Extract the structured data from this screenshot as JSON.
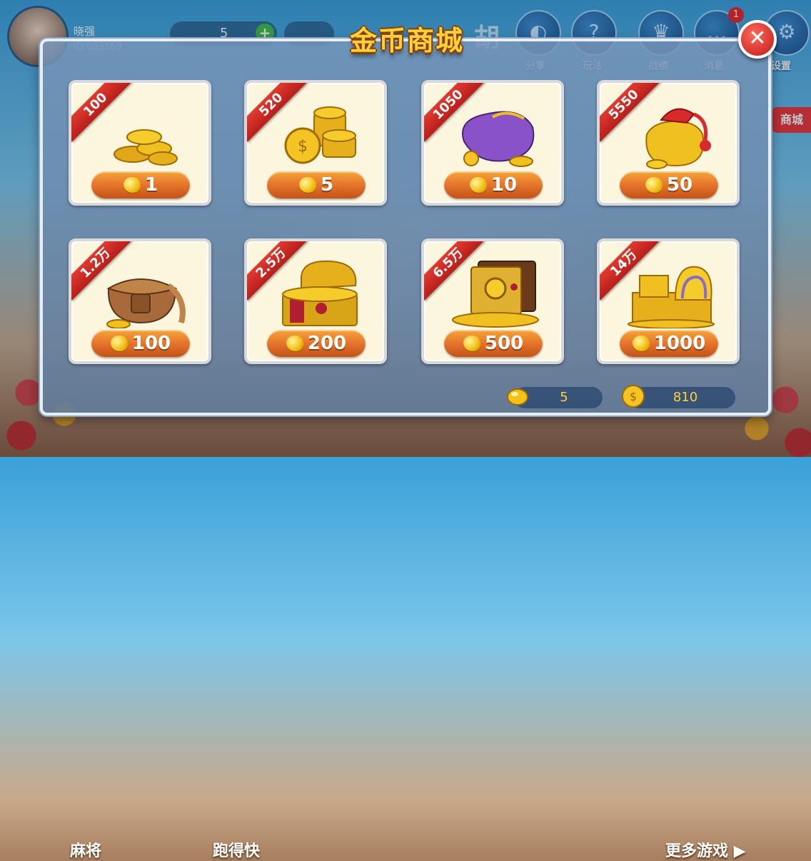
{
  "topbar": {
    "username": "晓强",
    "user_id": "ID:683169",
    "beans": "5",
    "add_symbol": "+",
    "banner_char": "胡",
    "buttons": [
      {
        "label": "分享",
        "icon": "share-icon"
      },
      {
        "label": "玩法",
        "icon": "help-icon"
      },
      {
        "label": "战绩",
        "icon": "trophy-icon"
      },
      {
        "label": "消息",
        "icon": "message-icon"
      },
      {
        "label": "设置",
        "icon": "gear-icon"
      }
    ],
    "message_badge": "1",
    "mall_tab": "商城"
  },
  "bottom": {
    "games": [
      "麻将",
      "跑得快"
    ],
    "more": "更多游戏"
  },
  "shop": {
    "title": "金币商城",
    "close_symbol": "✕",
    "items": [
      {
        "amount": "100",
        "price": "1"
      },
      {
        "amount": "520",
        "price": "5"
      },
      {
        "amount": "1050",
        "price": "10"
      },
      {
        "amount": "5550",
        "price": "50"
      },
      {
        "amount": "1.2万",
        "price": "100"
      },
      {
        "amount": "2.5万",
        "price": "200"
      },
      {
        "amount": "6.5万",
        "price": "500"
      },
      {
        "amount": "14万",
        "price": "1000"
      }
    ],
    "balance": {
      "beans": "5",
      "coins": "810"
    }
  },
  "colors": {
    "title_gold": "#ffd23c",
    "button_orange": "#e3702a",
    "ribbon_red": "#d02a24",
    "close_red": "#d82020"
  }
}
